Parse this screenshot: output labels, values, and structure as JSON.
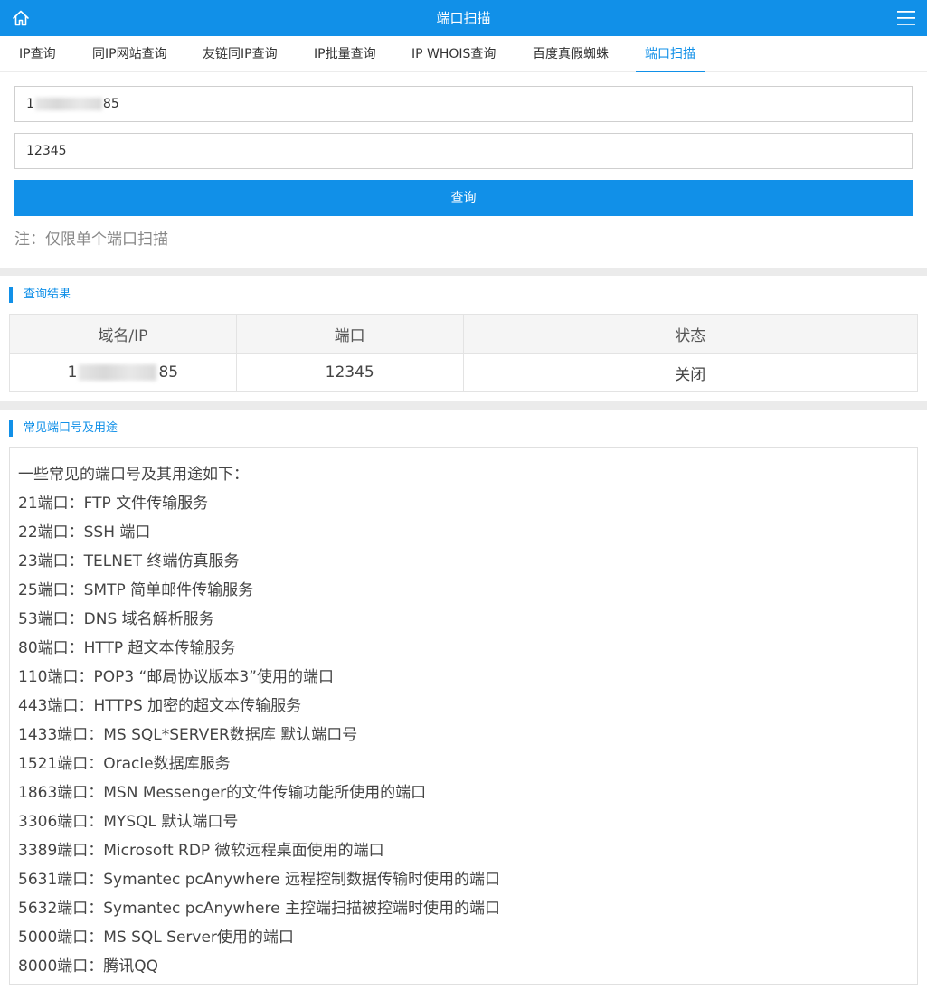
{
  "header": {
    "title": "端口扫描",
    "home_icon": "home-icon",
    "menu_icon": "hamburger-menu-icon"
  },
  "tabs": [
    {
      "label": "IP查询"
    },
    {
      "label": "同IP网站查询"
    },
    {
      "label": "友链同IP查询"
    },
    {
      "label": "IP批量查询"
    },
    {
      "label": "IP WHOIS查询"
    },
    {
      "label": "百度真假蜘蛛"
    },
    {
      "label": "端口扫描",
      "active": true
    }
  ],
  "form": {
    "ip_prefix": "1",
    "ip_suffix": "85",
    "port_value": "12345",
    "submit_label": "查询",
    "note": "注：仅限单个端口扫描"
  },
  "results": {
    "title": "查询结果",
    "headers": [
      "域名/IP",
      "端口",
      "状态"
    ],
    "row": {
      "ip_prefix": "1",
      "ip_suffix": "85",
      "port": "12345",
      "status": "关闭"
    }
  },
  "common_ports": {
    "title": "常见端口号及用途",
    "lines": [
      "一些常见的端口号及其用途如下：",
      "21端口：FTP 文件传输服务",
      "22端口：SSH 端口",
      "23端口：TELNET 终端仿真服务",
      "25端口：SMTP 简单邮件传输服务",
      "53端口：DNS 域名解析服务",
      "80端口：HTTP 超文本传输服务",
      "110端口：POP3 “邮局协议版本3”使用的端口",
      "443端口：HTTPS 加密的超文本传输服务",
      "1433端口：MS SQL*SERVER数据库 默认端口号",
      "1521端口：Oracle数据库服务",
      "1863端口：MSN Messenger的文件传输功能所使用的端口",
      "3306端口：MYSQL 默认端口号",
      "3389端口：Microsoft RDP 微软远程桌面使用的端口",
      "5631端口：Symantec pcAnywhere 远程控制数据传输时使用的端口",
      "5632端口：Symantec pcAnywhere 主控端扫描被控端时使用的端口",
      "5000端口：MS SQL Server使用的端口",
      "8000端口：腾讯QQ"
    ]
  },
  "colors": {
    "accent": "#1190e8",
    "status_closed": "#e0110f"
  }
}
